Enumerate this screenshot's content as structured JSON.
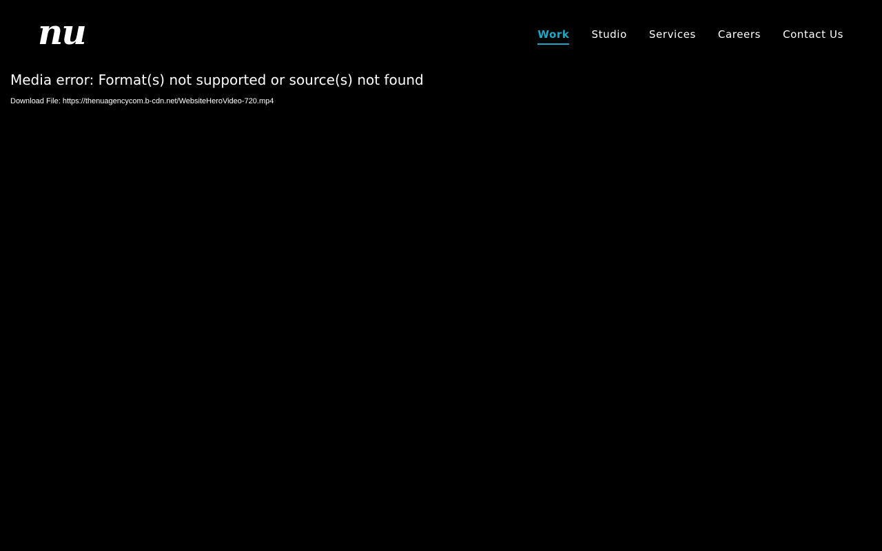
{
  "colors": {
    "background": "#000000",
    "text": "#ffffff",
    "accent": "#1aa8c8"
  },
  "header": {
    "logo_text": "nu",
    "nav": [
      {
        "label": "Work",
        "active": true
      },
      {
        "label": "Studio",
        "active": false
      },
      {
        "label": "Services",
        "active": false
      },
      {
        "label": "Careers",
        "active": false
      },
      {
        "label": "Contact Us",
        "active": false
      }
    ]
  },
  "media_error": {
    "message": "Media error: Format(s) not supported or source(s) not found",
    "download_prefix": "Download File: ",
    "download_url": "https://thenuagencycom.b-cdn.net/WebsiteHeroVideo-720.mp4"
  }
}
